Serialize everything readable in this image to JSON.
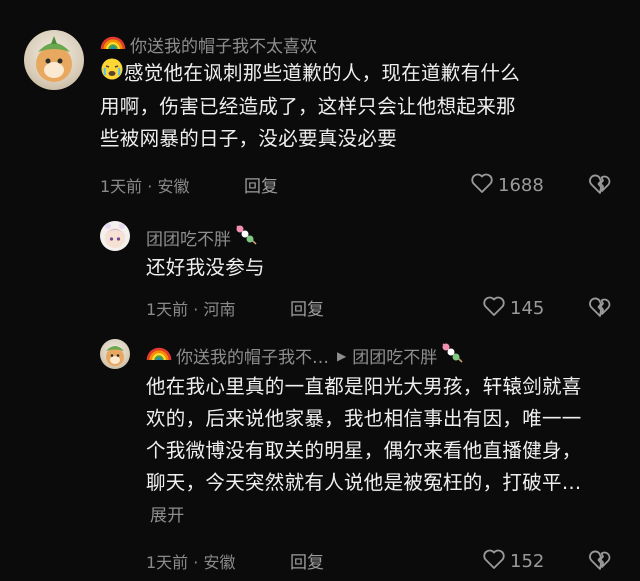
{
  "comments": [
    {
      "username": "你送我的帽子我不太喜欢",
      "text": "感觉他在讽刺那些道歉的人，现在道歉有什么用啊，伤害已经造成了，这样只会让他想起来那些被网暴的日子，没必要真没必要",
      "time_location": "1天前 · 安徽",
      "reply_label": "回复",
      "likes": "1688"
    },
    {
      "username": "团团吃不胖",
      "text": "还好我没参与",
      "time_location": "1天前 · 河南",
      "reply_label": "回复",
      "likes": "145"
    },
    {
      "username": "你送我的帽子我不…",
      "reply_to": "团团吃不胖",
      "text": "他在我心里真的一直都是阳光大男孩，轩辕剑就喜欢的，后来说他家暴，我也相信事出有因，唯一一个我微博没有取关的明星，偶尔来看他直播健身，聊天，今天突然就有人说他是被冤枉的，打破平…",
      "expand_label": "展开",
      "time_location": "1天前 · 安徽",
      "reply_label": "回复",
      "likes": "152"
    }
  ]
}
